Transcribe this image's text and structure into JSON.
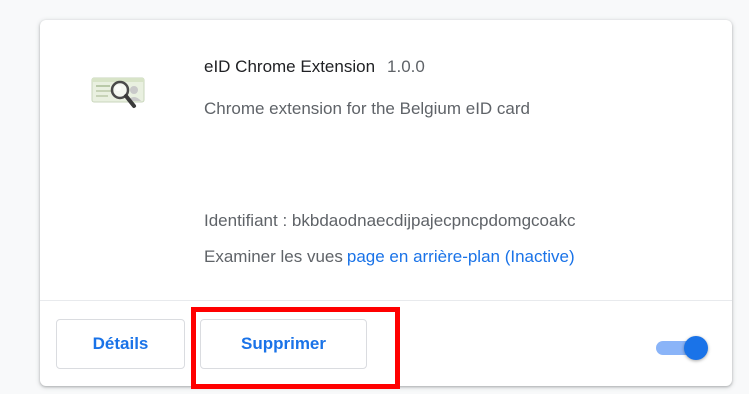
{
  "extension": {
    "name": "eID Chrome Extension",
    "version": "1.0.0",
    "description": "Chrome extension for the Belgium eID card",
    "id_label": "Identifiant :",
    "id_value": "bkbdaodnaecdijpajecpncpdomgcoakc",
    "views_label": "Examiner les vues",
    "views_link": "page en arrière-plan (Inactive)",
    "icon": "eid-card-magnifier-icon",
    "enabled": true
  },
  "actions": {
    "details_label": "Détails",
    "remove_label": "Supprimer"
  },
  "colors": {
    "accent": "#1a73e8",
    "highlight": "#ff0000",
    "toggle_track": "#8ab4f8"
  }
}
